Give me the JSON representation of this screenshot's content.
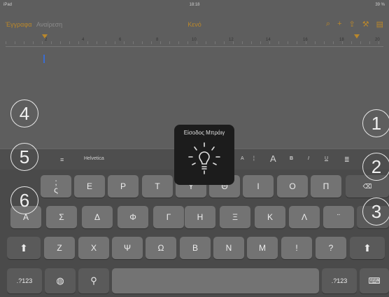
{
  "status": {
    "device": "iPad",
    "time": "18:18",
    "battery": "39 %"
  },
  "nav": {
    "documents": "Έγγραφα",
    "undo": "Αναίρεση",
    "title": "Κενό"
  },
  "ruler": {
    "ticks": [
      "2",
      "4",
      "6",
      "8",
      "10",
      "12",
      "14",
      "16",
      "18",
      "20"
    ]
  },
  "hud": {
    "title": "Είσοδος Μπράιγ"
  },
  "circles": [
    "1",
    "2",
    "3",
    "4",
    "5",
    "6"
  ],
  "format": {
    "font": "Helvetica",
    "a_small": "A",
    "a_large": "A",
    "bold": "B",
    "italic": "I",
    "underline": "U"
  },
  "keys": {
    "row1": [
      "ς",
      "Ε",
      "Ρ",
      "Τ",
      "Υ",
      "Θ",
      "Ι",
      "Ο",
      "Π"
    ],
    "row1_top": ";",
    "row2": [
      "Α",
      "Σ",
      "Δ",
      "Φ",
      "Γ",
      "Η",
      "Ξ",
      "Κ",
      "Λ",
      "¨"
    ],
    "row3": [
      "Ζ",
      "Χ",
      "Ψ",
      "Ω",
      "Β",
      "Ν",
      "Μ",
      "!",
      "?"
    ],
    "numbers_label": ".?123"
  },
  "icons": {
    "search": "magnifier-icon",
    "add": "plus-icon",
    "share": "share-icon",
    "tools": "wrench-icon",
    "doc": "document-icon",
    "shift": "shift-icon",
    "delete": "backspace-icon",
    "globe": "globe-icon",
    "mic": "microphone-icon",
    "hide": "keyboard-hide-icon"
  },
  "colors": {
    "accent": "#b9872b",
    "dim": "#5e5e5e",
    "hud": "#1c1c1c"
  }
}
